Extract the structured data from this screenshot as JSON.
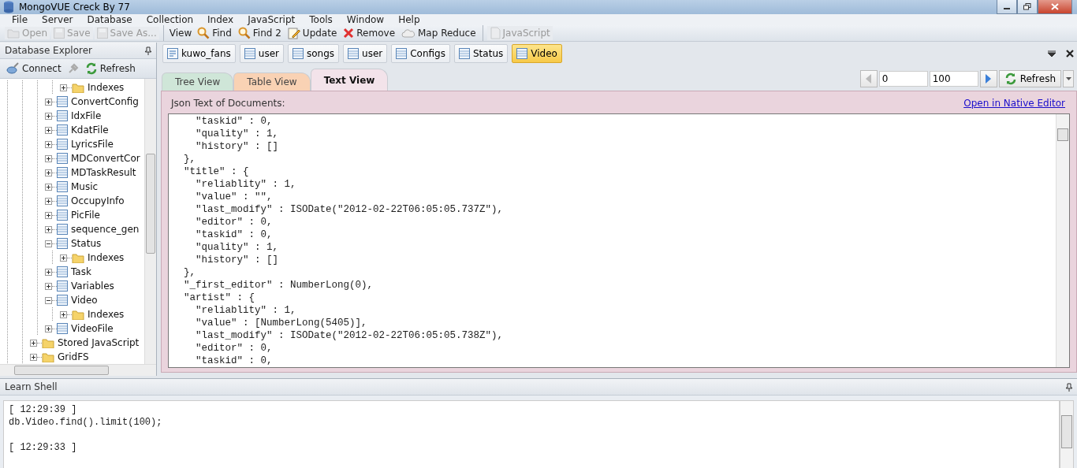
{
  "window": {
    "title": "MongoVUE Creck By 77"
  },
  "menu": [
    "File",
    "Server",
    "Database",
    "Collection",
    "Index",
    "JavaScript",
    "Tools",
    "Window",
    "Help"
  ],
  "toolbar": [
    {
      "kind": "open",
      "label": "Open",
      "disabled": true
    },
    {
      "kind": "save",
      "label": "Save",
      "disabled": true
    },
    {
      "kind": "save",
      "label": "Save As...",
      "disabled": true
    },
    {
      "kind": "text",
      "label": "View"
    },
    {
      "kind": "find",
      "label": "Find",
      "disabled": false
    },
    {
      "kind": "find",
      "label": "Find 2",
      "disabled": false
    },
    {
      "kind": "update",
      "label": "Update",
      "disabled": false
    },
    {
      "kind": "remove",
      "label": "Remove",
      "disabled": false
    },
    {
      "kind": "mapreduce",
      "label": "Map Reduce",
      "disabled": false
    },
    {
      "kind": "script",
      "label": "JavaScript",
      "disabled": true
    }
  ],
  "sidebar": {
    "title": "Database Explorer",
    "buttons": [
      {
        "kind": "connect",
        "label": "Connect"
      },
      {
        "kind": "refresh",
        "label": "Refresh"
      }
    ],
    "tree": {
      "scrolled_parent_children": [
        {
          "kind": "folder",
          "label": "Indexes",
          "expanded": false
        }
      ],
      "collections": [
        {
          "kind": "table",
          "label": "ConvertConfig",
          "expanded": false
        },
        {
          "kind": "table",
          "label": "IdxFile",
          "expanded": false
        },
        {
          "kind": "table",
          "label": "KdatFile",
          "expanded": false
        },
        {
          "kind": "table",
          "label": "LyricsFile",
          "expanded": false
        },
        {
          "kind": "table",
          "label": "MDConvertCor",
          "expanded": false
        },
        {
          "kind": "table",
          "label": "MDTaskResult",
          "expanded": false
        },
        {
          "kind": "table",
          "label": "Music",
          "expanded": false
        },
        {
          "kind": "table",
          "label": "OccupyInfo",
          "expanded": false
        },
        {
          "kind": "table",
          "label": "PicFile",
          "expanded": false
        },
        {
          "kind": "table",
          "label": "sequence_gen",
          "expanded": false
        },
        {
          "kind": "table",
          "label": "Status",
          "expanded": true,
          "children": [
            {
              "kind": "folder",
              "label": "Indexes",
              "expanded": false
            }
          ]
        },
        {
          "kind": "table",
          "label": "Task",
          "expanded": false
        },
        {
          "kind": "table",
          "label": "Variables",
          "expanded": false
        },
        {
          "kind": "table",
          "label": "Video",
          "expanded": true,
          "children": [
            {
              "kind": "folder",
              "label": "Indexes",
              "expanded": false
            }
          ]
        },
        {
          "kind": "table",
          "label": "VideoFile",
          "expanded": false
        }
      ],
      "groups": [
        {
          "kind": "folder",
          "label": "Stored JavaScript",
          "expanded": false
        },
        {
          "kind": "folder",
          "label": "GridFS",
          "expanded": false
        }
      ]
    }
  },
  "document_tabs": [
    {
      "kind": "database",
      "label": "kuwo_fans",
      "selected": false
    },
    {
      "kind": "table",
      "label": "user",
      "selected": false
    },
    {
      "kind": "table",
      "label": "songs",
      "selected": false
    },
    {
      "kind": "table",
      "label": "user",
      "selected": false
    },
    {
      "kind": "table",
      "label": "Configs",
      "selected": false
    },
    {
      "kind": "table",
      "label": "Status",
      "selected": false
    },
    {
      "kind": "table",
      "label": "Video",
      "selected": true
    }
  ],
  "view_tabs": [
    {
      "label": "Tree View",
      "selected": false,
      "color": "#cfe6d8"
    },
    {
      "label": "Table View",
      "selected": false,
      "color": "#f9d2b4"
    },
    {
      "label": "Text View",
      "selected": true,
      "color": "#f3e3ea"
    }
  ],
  "pager": {
    "skip": "0",
    "limit": "100",
    "refresh": "Refresh"
  },
  "text_view": {
    "heading": "Json Text of Documents:",
    "link": "Open in Native Editor",
    "lines": [
      "    \"taskid\" : 0,",
      "    \"quality\" : 1,",
      "    \"history\" : []",
      "  },",
      "  \"title\" : {",
      "    \"reliablity\" : 1,",
      "    \"value\" : \"\",",
      "    \"last_modify\" : ISODate(\"2012-02-22T06:05:05.737Z\"),",
      "    \"editor\" : 0,",
      "    \"taskid\" : 0,",
      "    \"quality\" : 1,",
      "    \"history\" : []",
      "  },",
      "  \"_first_editor\" : NumberLong(0),",
      "  \"artist\" : {",
      "    \"reliablity\" : 1,",
      "    \"value\" : [NumberLong(5405)],",
      "    \"last_modify\" : ISODate(\"2012-02-22T06:05:05.738Z\"),",
      "    \"editor\" : 0,",
      "    \"taskid\" : 0,"
    ]
  },
  "shell": {
    "title": "Learn Shell",
    "entries": [
      {
        "time": "[ 12:29:39 ]",
        "command": "db.Video.find().limit(100);"
      },
      {
        "time": "[ 12:29:33 ]"
      }
    ]
  }
}
